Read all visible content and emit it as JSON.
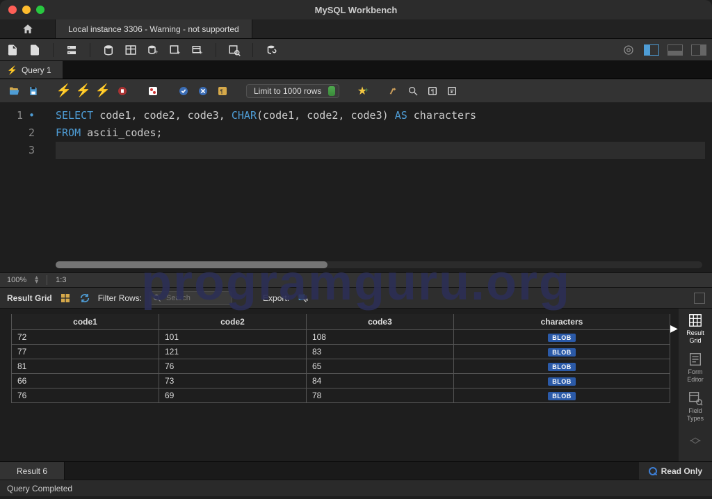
{
  "window": {
    "title": "MySQL Workbench"
  },
  "connection": {
    "tab_label": "Local instance 3306 - Warning - not supported"
  },
  "query_tab": {
    "label": "Query 1"
  },
  "query_toolbar": {
    "limit_label": "Limit to 1000 rows"
  },
  "editor": {
    "line1_kw1": "SELECT",
    "line1_rest1": " code1, code2, code3, ",
    "line1_fn": "CHAR",
    "line1_rest2": "(code1, code2, code3) ",
    "line1_kw2": "AS",
    "line1_rest3": " characters",
    "line2_kw": "FROM",
    "line2_rest": " ascii_codes;",
    "ln1": "1",
    "ln2": "2",
    "ln3": "3"
  },
  "zoom": {
    "percent": "100%",
    "cursor": "1:3"
  },
  "result_toolbar": {
    "label": "Result Grid",
    "filter_label": "Filter Rows:",
    "filter_placeholder": "Search",
    "export_label": "Export:"
  },
  "grid": {
    "columns": [
      "code1",
      "code2",
      "code3",
      "characters"
    ],
    "rows": [
      {
        "c1": "72",
        "c2": "101",
        "c3": "108",
        "c4": "BLOB"
      },
      {
        "c1": "77",
        "c2": "121",
        "c3": "83",
        "c4": "BLOB"
      },
      {
        "c1": "81",
        "c2": "76",
        "c3": "65",
        "c4": "BLOB"
      },
      {
        "c1": "66",
        "c2": "73",
        "c3": "84",
        "c4": "BLOB"
      },
      {
        "c1": "76",
        "c2": "69",
        "c3": "78",
        "c4": "BLOB"
      }
    ]
  },
  "side_panel": {
    "result_grid": "Result\nGrid",
    "form_editor": "Form\nEditor",
    "field_types": "Field\nTypes"
  },
  "result_tab": {
    "label": "Result 6"
  },
  "readonly": {
    "label": "Read Only"
  },
  "status": {
    "text": "Query Completed"
  },
  "watermark": {
    "text": "programguru.org"
  }
}
